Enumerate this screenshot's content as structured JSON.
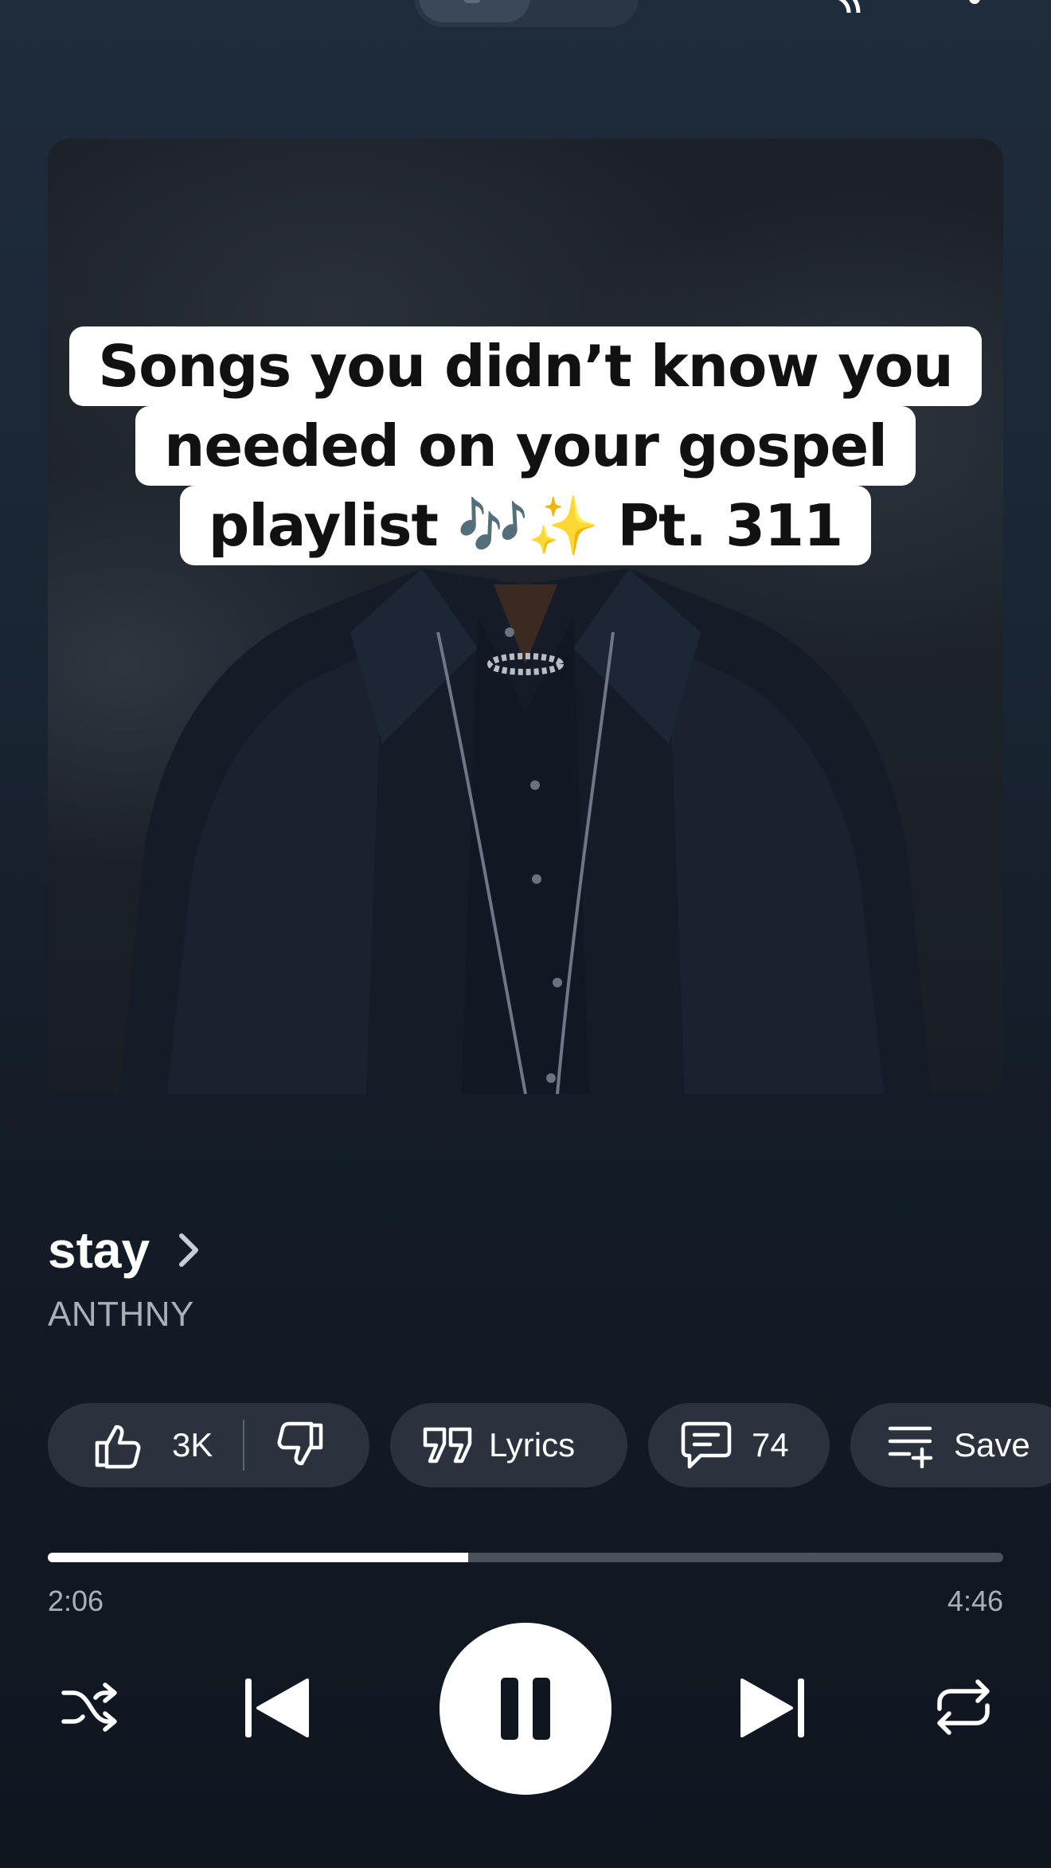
{
  "album_art": {
    "caption_lines": [
      "Songs you didn’t know you",
      "needed on your gospel",
      "playlist 🎶✨ Pt. 311"
    ]
  },
  "track": {
    "title": "stay",
    "artist": "ANTHNY"
  },
  "actions": {
    "like_count": "3K",
    "lyrics_label": "Lyrics",
    "comment_count": "74",
    "save_label": "Save"
  },
  "playback": {
    "current_time": "2:06",
    "total_time": "4:46",
    "progress_fraction": 0.44
  },
  "icons": {
    "top": [
      "cast-icon",
      "more-vertical-icon"
    ],
    "actions": [
      "thumbs-up-icon",
      "thumbs-down-icon",
      "quote-icon",
      "comment-icon",
      "playlist-add-icon"
    ],
    "controls": [
      "shuffle-icon",
      "skip-previous-icon",
      "pause-icon",
      "skip-next-icon",
      "repeat-icon"
    ]
  },
  "colors": {
    "background_top": "#1f2c3b",
    "background_bottom": "#0f1620",
    "chip_background": "#2a323d",
    "secondary_text": "#a9b0b8",
    "progress_track": "#4a525d"
  }
}
